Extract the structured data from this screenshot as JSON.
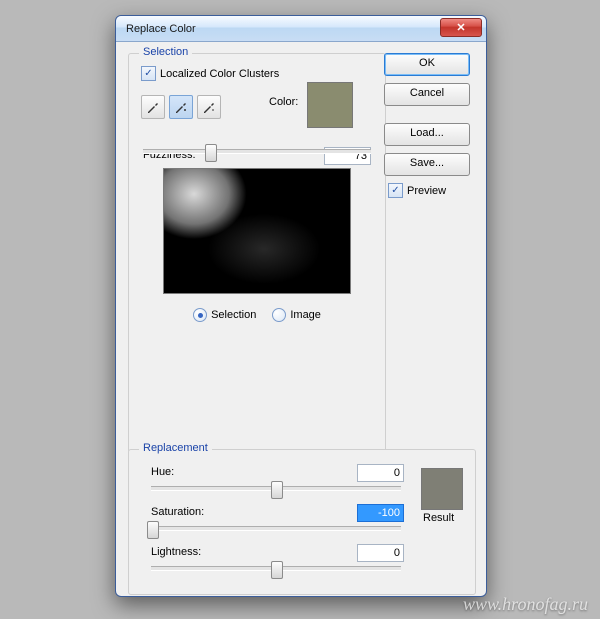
{
  "window": {
    "title": "Replace Color",
    "close_icon": "✕"
  },
  "buttons": {
    "ok": "OK",
    "cancel": "Cancel",
    "load": "Load...",
    "save": "Save..."
  },
  "preview": {
    "checkbox_label": "Preview",
    "checked": true
  },
  "selection": {
    "legend": "Selection",
    "localized_label": "Localized Color Clusters",
    "localized_checked": true,
    "color_label": "Color:",
    "color_value": "#8a8c6f",
    "fuzziness_label": "Fuzziness:",
    "fuzziness_value": "73",
    "radio_selection": "Selection",
    "radio_image": "Image",
    "radio_selected": "selection"
  },
  "replacement": {
    "legend": "Replacement",
    "hue_label": "Hue:",
    "hue_value": "0",
    "saturation_label": "Saturation:",
    "saturation_value": "-100",
    "lightness_label": "Lightness:",
    "lightness_value": "0",
    "result_label": "Result",
    "result_color": "#7f7f75"
  },
  "watermark": "www.hronofag.ru"
}
